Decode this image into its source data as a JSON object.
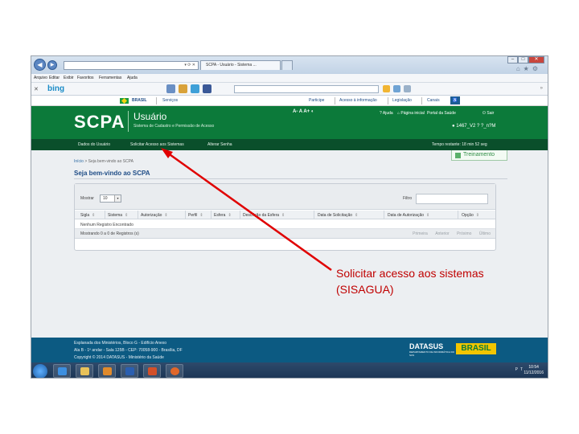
{
  "browser": {
    "address": "",
    "tab_title": "SCPA - Usuário - Sistema ...",
    "menu": [
      "Arquivo",
      "Editar",
      "Exibir",
      "Favoritos",
      "Ferramentas",
      "Ajuda"
    ],
    "bing_label": "bing"
  },
  "govbar": {
    "brasil": "BRASIL",
    "servicos": "Serviços",
    "links": [
      "Participe",
      "Acesso à informação",
      "Legislação",
      "Canais"
    ]
  },
  "header": {
    "logo": "SCPA",
    "subtitle": "Usuário",
    "description": "Sistema de Cadastro e Permissão de Acesso",
    "font_controls": "A-  A  A+  ◐",
    "links": [
      "? Ajuda",
      "⌂ Página inicial",
      "Portal da Saúde"
    ],
    "sair": "Sair",
    "user": "1467_V2 ? ?_n?M"
  },
  "nav": {
    "items": [
      "Dados do Usuário",
      "Solicitar Acesso aos Sistemas",
      "Alterar Senha"
    ],
    "session": "Tempo restante: 18 min 52 seg"
  },
  "content": {
    "breadcrumb_home": "Início",
    "breadcrumb_current": "> Seja bem-vindo ao SCPA",
    "treinamento": "Treinamento",
    "welcome": "Seja bem-vindo ao SCPA"
  },
  "table": {
    "mostrar_label": "Mostrar",
    "mostrar_value": "10",
    "filtro_label": "Filtro",
    "columns": [
      "Sigla",
      "Sistema",
      "Autorização",
      "Perfil",
      "Esfera",
      "Descrição da Esfera",
      "Data de Solicitação",
      "Data de Autorização",
      "Opção"
    ],
    "empty_message": "Nenhum Registro Encontrado",
    "info": "Mostrando 0 a 0 de Registros (s)",
    "pager": [
      "Primeira",
      "Anterior",
      "Próximo",
      "Último"
    ]
  },
  "footer": {
    "lines": [
      "Esplanada dos Ministérios, Bloco G - Edifício Anexo",
      "Ala B - 1º andar - Sala 125B - CEP: 70058-900 - Brasília, DF",
      "Copyright © 2014 DATASUS - Ministério da Saúde"
    ],
    "datasus": "DATASUS",
    "datasus_sub": "DEPARTAMENTO DE INFORMÁTICA DO SUS",
    "brasil_logo": "BRASIL"
  },
  "taskbar": {
    "tray": "PT",
    "time": "10:54",
    "date": "11/12/2016"
  },
  "annotation": {
    "line1": "Solicitar acesso aos sistemas",
    "line2": "(SISAGUA)",
    "color": "#e00000"
  }
}
